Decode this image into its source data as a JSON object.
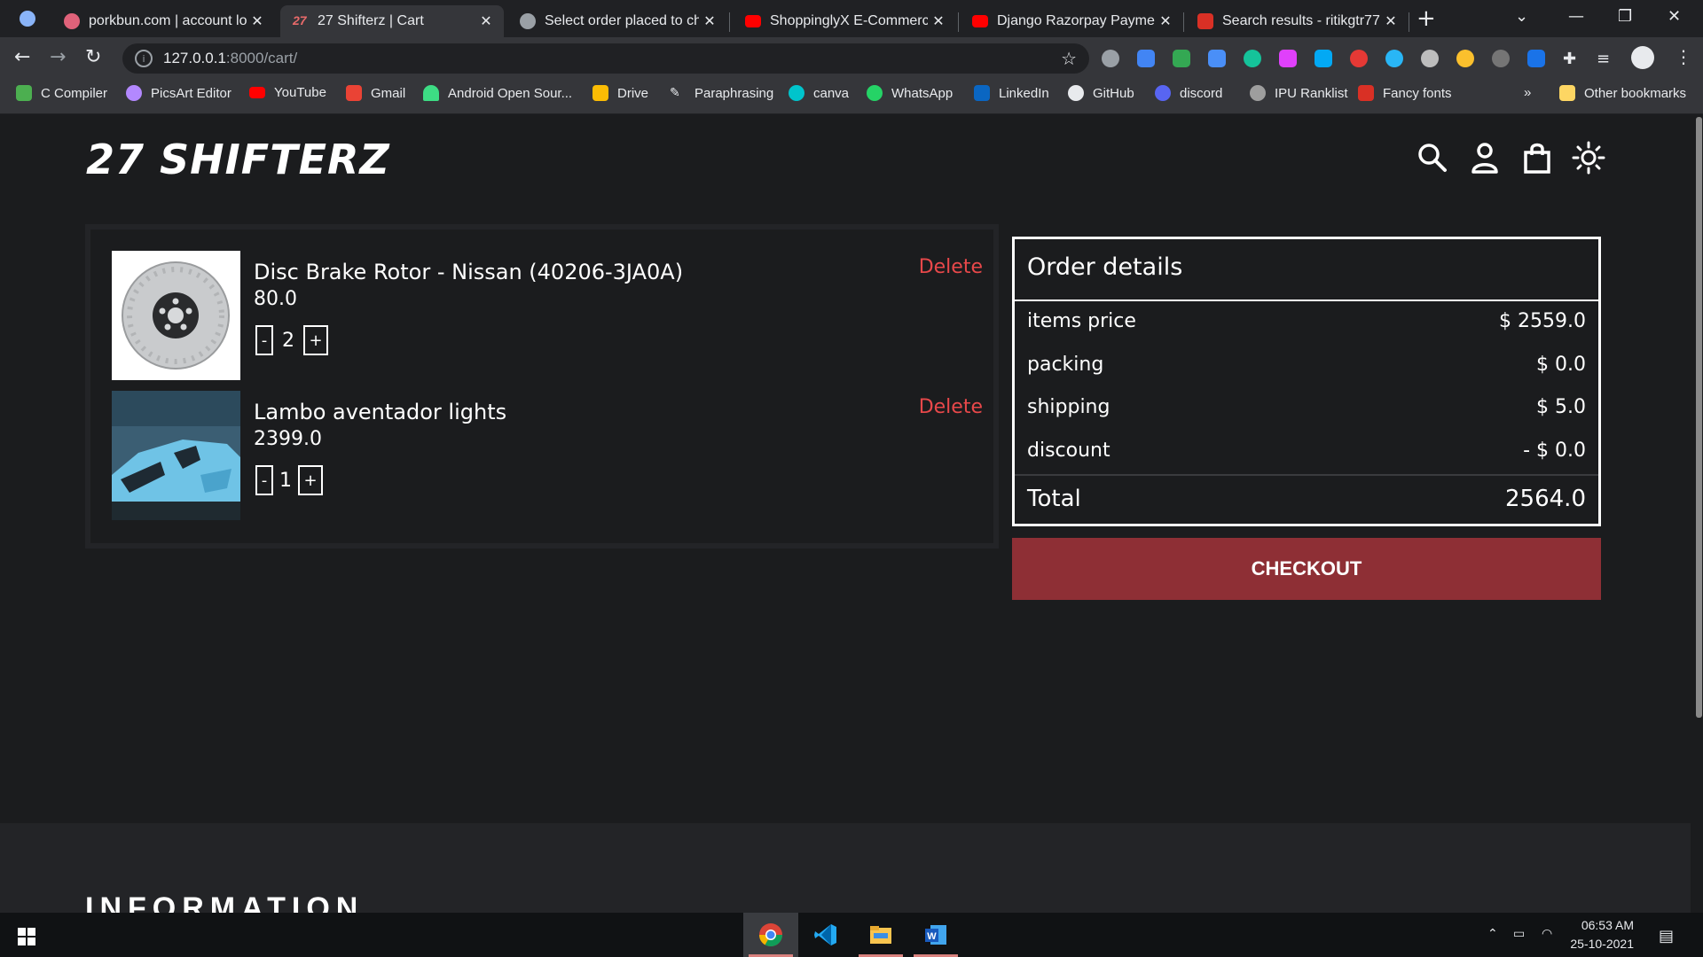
{
  "browser": {
    "tabs": [
      {
        "label": "porkbun.com | account lo",
        "active": false,
        "favicon_color": "#e0627a",
        "favicon": "porkbun-favicon-icon"
      },
      {
        "label": "27 Shifterz | Cart",
        "active": true,
        "favicon_color": "#e86a6a",
        "favicon": "shifterz-favicon-icon"
      },
      {
        "label": "Select order placed to cha",
        "active": false,
        "favicon_color": "#9aa0a6",
        "favicon": "globe-icon"
      },
      {
        "label": "ShoppinglyX E-Commerce",
        "active": false,
        "favicon_color": "#ff0000",
        "favicon": "youtube-icon"
      },
      {
        "label": "Django Razorpay Payment",
        "active": false,
        "favicon_color": "#ff0000",
        "favicon": "youtube-icon"
      },
      {
        "label": "Search results - ritikgtr77",
        "active": false,
        "favicon_color": "#d93025",
        "favicon": "gmail-icon"
      }
    ],
    "url_host": "127.0.0.1",
    "url_path": ":8000/cart/",
    "bookmarks": [
      {
        "label": "C Compiler",
        "color": "#4caf50"
      },
      {
        "label": "PicsArt Editor",
        "color": "#b388ff"
      },
      {
        "label": "YouTube",
        "color": "#ff0000"
      },
      {
        "label": "Gmail",
        "color": "#ea4335"
      },
      {
        "label": "Android Open Sour...",
        "color": "#3ddc84"
      },
      {
        "label": "Drive",
        "color": "#fbbc04"
      },
      {
        "label": "Paraphrasing",
        "color": "#e8eaed"
      },
      {
        "label": "canva",
        "color": "#00c4cc"
      },
      {
        "label": "WhatsApp",
        "color": "#25d366"
      },
      {
        "label": "LinkedIn",
        "color": "#0a66c2"
      },
      {
        "label": "GitHub",
        "color": "#e8eaed"
      },
      {
        "label": "discord",
        "color": "#5865f2"
      },
      {
        "label": "IPU Ranklist",
        "color": "#e8eaed"
      },
      {
        "label": "Fancy fonts",
        "color": "#d93025"
      }
    ],
    "more_bookmarks": "»",
    "other_bookmarks": "Other bookmarks"
  },
  "site": {
    "logo": "27 SHIFTERZ",
    "cart_items": [
      {
        "name": "Disc Brake Rotor - Nissan (40206-3JA0A)",
        "price": "80.0",
        "qty": "2",
        "delete_label": "Delete",
        "image": "brake-rotor-image"
      },
      {
        "name": "Lambo aventador lights",
        "price": "2399.0",
        "qty": "1",
        "delete_label": "Delete",
        "image": "lamborghini-image"
      }
    ],
    "qty_minus": "-",
    "qty_plus": "+",
    "order": {
      "title": "Order details",
      "rows": [
        {
          "label": "items price",
          "value": "$ 2559.0"
        },
        {
          "label": "packing",
          "value": "$ 0.0"
        },
        {
          "label": "shipping",
          "value": "$ 5.0"
        },
        {
          "label": "discount",
          "value": "- $ 0.0"
        }
      ],
      "total_label": "Total",
      "total_value": "2564.0"
    },
    "checkout_label": "CHECKOUT",
    "info_heading": "INFORMATION",
    "accent": "#8e2f35",
    "delete_color": "#e8484a"
  },
  "taskbar": {
    "time": "06:53 AM",
    "date": "25-10-2021"
  }
}
